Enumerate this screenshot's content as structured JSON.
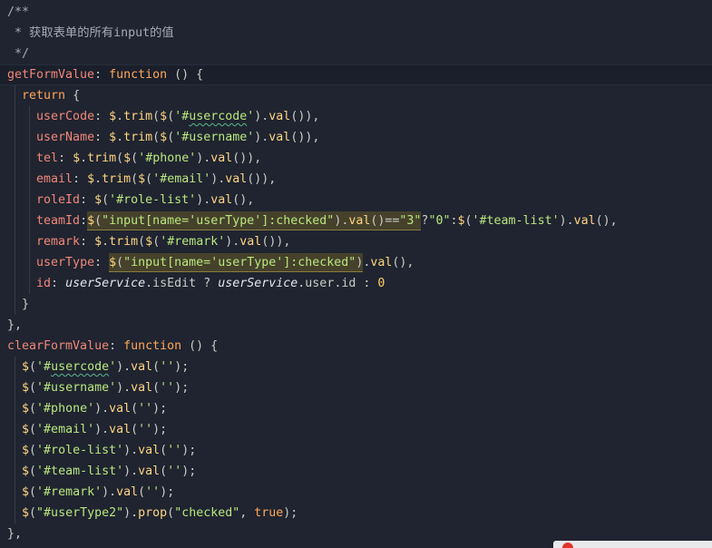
{
  "editor": {
    "theme": {
      "background": "#1f2430",
      "active_line": "#1a1f2b",
      "active_line_border": "#272d3b",
      "comment": "#a4aab6",
      "keyword": "#ffa759",
      "property": "#f28779",
      "func": "#ffd580",
      "string": "#bae67e",
      "punct": "#cbccc6",
      "variable": "#e3e6ed",
      "member": "#cbccc6",
      "number": "#ffcc66",
      "match_highlight": "#45412b",
      "match_border": "#8c7c3e",
      "indent_guide": "#363b4a",
      "squiggle": "#5cb88f"
    },
    "lines": [
      {
        "tokens": [
          {
            "comment": "/**"
          }
        ]
      },
      {
        "tokens": [
          {
            "comment": " * 获取表单的所有input的值"
          }
        ]
      },
      {
        "tokens": [
          {
            "comment": " */"
          }
        ]
      },
      {
        "active": true,
        "tokens": [
          {
            "property": "getFormValue"
          },
          {
            "punct": ": "
          },
          {
            "keyword": "function"
          },
          {
            "punct": " () {"
          }
        ]
      },
      {
        "tokens": [
          {
            "punct": "  "
          },
          {
            "keyword": "return"
          },
          {
            "punct": " {"
          }
        ]
      },
      {
        "tokens": [
          {
            "punct": "    "
          },
          {
            "property": "userCode"
          },
          {
            "punct": ": "
          },
          {
            "func": "$"
          },
          {
            "punct": "."
          },
          {
            "func": "trim"
          },
          {
            "punct": "("
          },
          {
            "func": "$"
          },
          {
            "punct": "("
          },
          {
            "string": "'#"
          },
          {
            "string": "usercode",
            "squiggle": true
          },
          {
            "string": "'"
          },
          {
            "punct": ")."
          },
          {
            "func": "val"
          },
          {
            "punct": "()),"
          }
        ]
      },
      {
        "tokens": [
          {
            "punct": "    "
          },
          {
            "property": "userName"
          },
          {
            "punct": ": "
          },
          {
            "func": "$"
          },
          {
            "punct": "."
          },
          {
            "func": "trim"
          },
          {
            "punct": "("
          },
          {
            "func": "$"
          },
          {
            "punct": "("
          },
          {
            "string": "'#username'"
          },
          {
            "punct": ")."
          },
          {
            "func": "val"
          },
          {
            "punct": "()),"
          }
        ]
      },
      {
        "tokens": [
          {
            "punct": "    "
          },
          {
            "property": "tel"
          },
          {
            "punct": ": "
          },
          {
            "func": "$"
          },
          {
            "punct": "."
          },
          {
            "func": "trim"
          },
          {
            "punct": "("
          },
          {
            "func": "$"
          },
          {
            "punct": "("
          },
          {
            "string": "'#phone'"
          },
          {
            "punct": ")."
          },
          {
            "func": "val"
          },
          {
            "punct": "()),"
          }
        ]
      },
      {
        "tokens": [
          {
            "punct": "    "
          },
          {
            "property": "email"
          },
          {
            "punct": ": "
          },
          {
            "func": "$"
          },
          {
            "punct": "."
          },
          {
            "func": "trim"
          },
          {
            "punct": "("
          },
          {
            "func": "$"
          },
          {
            "punct": "("
          },
          {
            "string": "'#email'"
          },
          {
            "punct": ")."
          },
          {
            "func": "val"
          },
          {
            "punct": "()),"
          }
        ]
      },
      {
        "tokens": [
          {
            "punct": "    "
          },
          {
            "property": "roleId"
          },
          {
            "punct": ": "
          },
          {
            "func": "$"
          },
          {
            "punct": "("
          },
          {
            "string": "'#role-list'"
          },
          {
            "punct": ")."
          },
          {
            "func": "val"
          },
          {
            "punct": "(),"
          }
        ]
      },
      {
        "tokens": [
          {
            "punct": "    "
          },
          {
            "property": "teamId"
          },
          {
            "punct": ":"
          },
          {
            "func": "$",
            "match": true
          },
          {
            "punct": "(",
            "match": true
          },
          {
            "string": "\"input[name='userType']:checked\"",
            "match": true
          },
          {
            "punct": ").",
            "match": true
          },
          {
            "func": "val",
            "match": true
          },
          {
            "punct": "()==",
            "match": true
          },
          {
            "string": "\"3\"",
            "match": true
          },
          {
            "punct": "?"
          },
          {
            "string": "\"0\""
          },
          {
            "punct": ":"
          },
          {
            "func": "$"
          },
          {
            "punct": "("
          },
          {
            "string": "'#team-list'"
          },
          {
            "punct": ")."
          },
          {
            "func": "val"
          },
          {
            "punct": "(),"
          }
        ]
      },
      {
        "tokens": [
          {
            "punct": "    "
          },
          {
            "property": "remark"
          },
          {
            "punct": ": "
          },
          {
            "func": "$"
          },
          {
            "punct": "."
          },
          {
            "func": "trim"
          },
          {
            "punct": "("
          },
          {
            "func": "$"
          },
          {
            "punct": "("
          },
          {
            "string": "'#remark'"
          },
          {
            "punct": ")."
          },
          {
            "func": "val"
          },
          {
            "punct": "()),"
          }
        ]
      },
      {
        "tokens": [
          {
            "punct": "    "
          },
          {
            "property": "userType"
          },
          {
            "punct": ": "
          },
          {
            "func": "$",
            "match": true
          },
          {
            "punct": "(",
            "match": true
          },
          {
            "string": "\"input[name='userType']:checked\"",
            "match": true
          },
          {
            "punct": ")",
            "match": true
          },
          {
            "punct": "."
          },
          {
            "func": "val"
          },
          {
            "punct": "(),"
          }
        ]
      },
      {
        "tokens": [
          {
            "punct": "    "
          },
          {
            "property": "id"
          },
          {
            "punct": ": "
          },
          {
            "variable": "userService"
          },
          {
            "punct": "."
          },
          {
            "member": "isEdit"
          },
          {
            "punct": " ? "
          },
          {
            "variable": "userService"
          },
          {
            "punct": "."
          },
          {
            "member": "user"
          },
          {
            "punct": "."
          },
          {
            "member": "id"
          },
          {
            "punct": " : "
          },
          {
            "number": "0"
          }
        ]
      },
      {
        "tokens": [
          {
            "punct": "  }"
          }
        ]
      },
      {
        "tokens": [
          {
            "punct": "},"
          }
        ]
      },
      {
        "tokens": [
          {
            "property": "clearFormValue"
          },
          {
            "punct": ": "
          },
          {
            "keyword": "function"
          },
          {
            "punct": " () {"
          }
        ]
      },
      {
        "tokens": [
          {
            "punct": "  "
          },
          {
            "func": "$"
          },
          {
            "punct": "("
          },
          {
            "string": "'#"
          },
          {
            "string": "usercode",
            "squiggle": true
          },
          {
            "string": "'"
          },
          {
            "punct": ")."
          },
          {
            "func": "val"
          },
          {
            "punct": "("
          },
          {
            "string": "''"
          },
          {
            "punct": ");"
          }
        ]
      },
      {
        "tokens": [
          {
            "punct": "  "
          },
          {
            "func": "$"
          },
          {
            "punct": "("
          },
          {
            "string": "'#username'"
          },
          {
            "punct": ")."
          },
          {
            "func": "val"
          },
          {
            "punct": "("
          },
          {
            "string": "''"
          },
          {
            "punct": ");"
          }
        ]
      },
      {
        "tokens": [
          {
            "punct": "  "
          },
          {
            "func": "$"
          },
          {
            "punct": "("
          },
          {
            "string": "'#phone'"
          },
          {
            "punct": ")."
          },
          {
            "func": "val"
          },
          {
            "punct": "("
          },
          {
            "string": "''"
          },
          {
            "punct": ");"
          }
        ]
      },
      {
        "tokens": [
          {
            "punct": "  "
          },
          {
            "func": "$"
          },
          {
            "punct": "("
          },
          {
            "string": "'#email'"
          },
          {
            "punct": ")."
          },
          {
            "func": "val"
          },
          {
            "punct": "("
          },
          {
            "string": "''"
          },
          {
            "punct": ");"
          }
        ]
      },
      {
        "tokens": [
          {
            "punct": "  "
          },
          {
            "func": "$"
          },
          {
            "punct": "("
          },
          {
            "string": "'#role-list'"
          },
          {
            "punct": ")."
          },
          {
            "func": "val"
          },
          {
            "punct": "("
          },
          {
            "string": "''"
          },
          {
            "punct": ");"
          }
        ]
      },
      {
        "tokens": [
          {
            "punct": "  "
          },
          {
            "func": "$"
          },
          {
            "punct": "("
          },
          {
            "string": "'#team-list'"
          },
          {
            "punct": ")."
          },
          {
            "func": "val"
          },
          {
            "punct": "("
          },
          {
            "string": "''"
          },
          {
            "punct": ");"
          }
        ]
      },
      {
        "tokens": [
          {
            "punct": "  "
          },
          {
            "func": "$"
          },
          {
            "punct": "("
          },
          {
            "string": "'#remark'"
          },
          {
            "punct": ")."
          },
          {
            "func": "val"
          },
          {
            "punct": "("
          },
          {
            "string": "''"
          },
          {
            "punct": ");"
          }
        ]
      },
      {
        "tokens": [
          {
            "punct": "  "
          },
          {
            "func": "$"
          },
          {
            "punct": "("
          },
          {
            "string": "\"#userType2\""
          },
          {
            "punct": ")."
          },
          {
            "func": "prop"
          },
          {
            "punct": "("
          },
          {
            "string": "\"checked\""
          },
          {
            "punct": ", "
          },
          {
            "keyword": "true"
          },
          {
            "punct": ");"
          }
        ]
      },
      {
        "tokens": [
          {
            "punct": "},"
          }
        ]
      }
    ]
  },
  "notification": {
    "icon": "error-icon",
    "background": "#e9e9ec",
    "icon_color": "#e0352b"
  }
}
